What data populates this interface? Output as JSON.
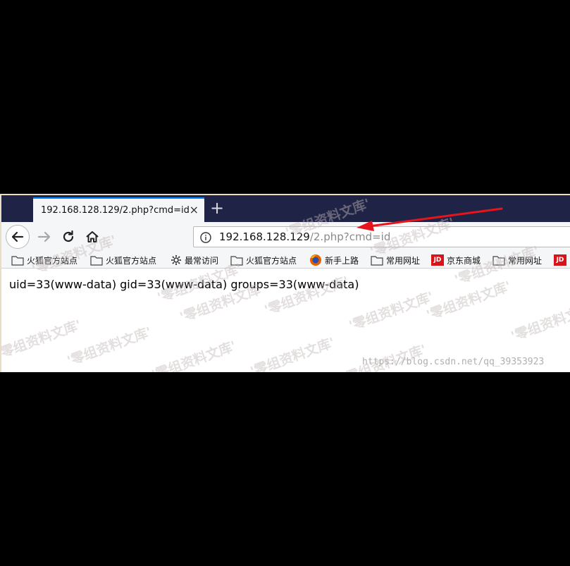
{
  "tab": {
    "title": "192.168.128.129/2.php?cmd=id",
    "close_glyph": "×",
    "new_tab_glyph": "+"
  },
  "urlbar": {
    "host": "192.168.128.129",
    "path": "/2.php?cmd=id"
  },
  "bookmarks": [
    {
      "label": "火狐官方站点",
      "icon": "folder-icon"
    },
    {
      "label": "火狐官方站点",
      "icon": "folder-icon"
    },
    {
      "label": "最常访问",
      "icon": "gear-icon"
    },
    {
      "label": "火狐官方站点",
      "icon": "folder-icon"
    },
    {
      "label": "新手上路",
      "icon": "firefox-icon"
    },
    {
      "label": "常用网址",
      "icon": "folder-icon"
    },
    {
      "label": "京东商城",
      "icon": "jd-icon"
    },
    {
      "label": "常用网址",
      "icon": "folder-icon"
    }
  ],
  "jd_badge": "JD",
  "page": {
    "output": "uid=33(www-data) gid=33(www-data) groups=33(www-data)"
  },
  "watermark": {
    "text": "'零组资料文库'",
    "url": "https://blog.csdn.net/qq_39353923"
  },
  "colors": {
    "tabbar": "#1f2447",
    "tab_accent": "#0a84ff",
    "arrow": "#e8141b",
    "jd_red": "#d7141a"
  }
}
